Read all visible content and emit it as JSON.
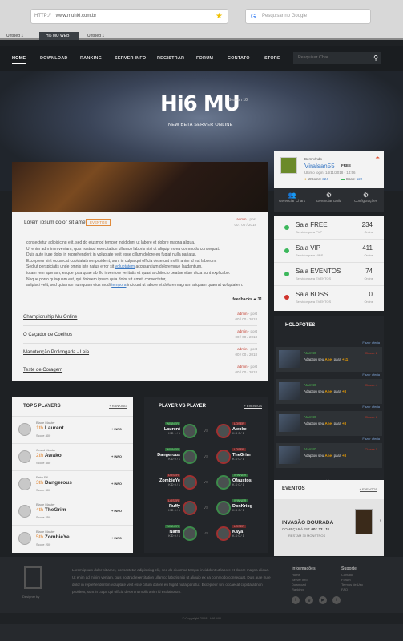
{
  "browser": {
    "protocol": "HTTP://",
    "url": "www.muhi6.com.br",
    "search_placeholder": "Pesquisar no Google",
    "tabs": [
      "Untitled 1",
      "Hi6 MU WEB",
      "Untitled 1"
    ]
  },
  "nav": {
    "items": [
      "HOME",
      "DOWNLOAD",
      "RANKING",
      "SERVER INFO",
      "REGISTRAR",
      "FORUM",
      "CONTATO",
      "STORE"
    ],
    "search_placeholder": "Pesquisar Char"
  },
  "hero": {
    "logo": "Hi6 MU",
    "season": "Season 10",
    "subtitle": "NEW BETA SERVER ONLINE"
  },
  "post": {
    "title": "Lorem ipsum dolor sit amet",
    "badge": "EVENTOS",
    "author": "admin",
    "meta_sep": " - ",
    "meta_type": "post",
    "date": "00 / 00 / 2018",
    "lines": [
      "consectetur adipisicing elit, sed do eiusmod tempor incididunt ut labore et dolore magna aliqua.",
      "Ut enim ad minim veniam, quis nostrud exercitation ullamco laboris nisi ut aliquip ex ea commodo consequat.",
      "Duis aute irure dolor in reprehenderit in voluptate velit esse cillum dolore eu fugiat nulla pariatur.",
      "Excepteur sint occaecat cupidatat non proident, sunt in culpa qui officia deserunt mollit anim id est laborum.",
      "Sed ut perspiciatis unde omnis iste natus error sit",
      "voluptatem",
      " accusantium doloremque laudantium,",
      "totam rem aperiam, eaque ipsa quae ab illo inventore veritatis et quasi architecto beatae vitae dicta sunt explicabo.",
      "Neque porro quisquam est, qui dolorem ipsum quia dolor sit amet, consectetur,",
      "adipisci velit, sed quia non numquam eius modi ",
      "tempora",
      " incidunt ut labore et dolore magnam aliquam quaerat voluptatem."
    ],
    "feedbacks_label": "feedbacks",
    "feedbacks_count": "31"
  },
  "posts": [
    {
      "title": "Championship Mu Online",
      "author": "admin",
      "meta_type": "post",
      "date": "00 / 00 / 2018"
    },
    {
      "title": "O Caçador de Coelhos",
      "author": "admin",
      "meta_type": "post",
      "date": "00 / 00 / 2018"
    },
    {
      "title": "Manutenção Prolongada - Leia",
      "author": "admin",
      "meta_type": "post",
      "date": "00 / 00 / 2018"
    },
    {
      "title": "Teste de Coragem",
      "author": "admin",
      "meta_type": "post",
      "date": "00 / 00 / 2018"
    }
  ],
  "user": {
    "welcome": "Bem Vindo",
    "name": "Viralsan55",
    "plan": "FREE",
    "last_login": "Último login: 14/11/2018 - 14:56",
    "wcoins_label": "WCoins:",
    "wcoins": "324",
    "cash_label": "Cash:",
    "cash": "122",
    "buttons": [
      "Gerenciar Chars",
      "Gerenciar Guild",
      "Configurações"
    ]
  },
  "servers": [
    {
      "name": "Sala FREE",
      "desc": "Servidor para PVP",
      "count": "234",
      "status": "Online",
      "color": "#3cb85c"
    },
    {
      "name": "Sala VIP",
      "desc": "Servidor para VIPS",
      "count": "411",
      "status": "Online",
      "color": "#3cb85c"
    },
    {
      "name": "Sala EVENTOS",
      "desc": "Servidor para EVENTOS",
      "count": "74",
      "status": "Online",
      "color": "#3cb85c"
    },
    {
      "name": "Sala BOSS",
      "desc": "Servidor para EVENTOS",
      "count": "0",
      "status": "Online",
      "color": "#d0342c"
    }
  ],
  "holofotes": {
    "title": "HOLOFOTES",
    "action_label": "Fazer oferta",
    "items": [
      {
        "who": "Atam40",
        "cls": "Classe 2",
        "pre": "Adaptou seu",
        "item": "Anel",
        "mid": "para",
        "lvl": "+11"
      },
      {
        "who": "Atam40",
        "cls": "Classe 4",
        "pre": "Adaptou seu",
        "item": "Anel",
        "mid": "para",
        "lvl": "+8"
      },
      {
        "who": "Atam40",
        "cls": "Classe 6",
        "pre": "Adaptou seu",
        "item": "Anel",
        "mid": "para",
        "lvl": "+8"
      },
      {
        "who": "Atam40",
        "cls": "Classe 1",
        "pre": "Adaptou seu",
        "item": "Anel",
        "mid": "para",
        "lvl": "+8"
      }
    ]
  },
  "top5": {
    "title": "TOP 5 PLAYERS",
    "link": "+ RANKING",
    "info_label": "+ INFO",
    "score_label": "Score",
    "players": [
      {
        "cls": "Blade Master",
        "rank": "1th",
        "name": "Laurent",
        "score": "400"
      },
      {
        "cls": "Grand Master",
        "rank": "2th",
        "name": "Awako",
        "score": "350"
      },
      {
        "cls": "Fairy Elf",
        "rank": "3th",
        "name": "Dangerous",
        "score": "300"
      },
      {
        "cls": "Blade Master",
        "rank": "4th",
        "name": "TheGrim",
        "score": "250"
      },
      {
        "cls": "Blade Master",
        "rank": "5th",
        "name": "ZombieYe",
        "score": "200"
      }
    ]
  },
  "pvp": {
    "title": "PLAYER VS PLAYER",
    "link": "+ EVENTOS",
    "vs": "VS",
    "duels": [
      {
        "l_tag": "WINNER",
        "l_name": "Laurent",
        "l_kd": "K.D 1 / 1",
        "r_tag": "LOSER",
        "r_name": "Awoke",
        "r_kd": "K.D 0 / 1"
      },
      {
        "l_tag": "WINNER",
        "l_name": "Dangerous",
        "l_kd": "K.D 0 / 1",
        "r_tag": "LOSER",
        "r_name": "TheGrim",
        "r_kd": "K.D 0 / 1"
      },
      {
        "l_tag": "LOSER",
        "l_name": "ZombieYe",
        "l_kd": "K.D 0 / 1",
        "r_tag": "WINNER",
        "r_name": "Ofaustos",
        "r_kd": "K.D 0 / 1"
      },
      {
        "l_tag": "LOSER",
        "l_name": "Ruffy",
        "l_kd": "K.D 0 / 1",
        "r_tag": "WINNER",
        "r_name": "DonKriog",
        "r_kd": "K.D 0 / 1"
      },
      {
        "l_tag": "WINNER",
        "l_name": "Nami",
        "l_kd": "K.D 0 / 1",
        "r_tag": "LOSER",
        "r_name": "Kaya",
        "r_kd": "K.D 0 / 1"
      }
    ]
  },
  "eventos": {
    "title": "EVENTOS",
    "link": "+ EVENTOS",
    "event": "INVASÃO DOURADA",
    "begins_label": "COMEÇARÁ EM:",
    "time": "00 : 32 : 11",
    "remaining": "RESTAM 30 MONSTROS"
  },
  "footer": {
    "designer": "Designer by",
    "text": "Lorem ipsum dolor sit amet, consectetur adipisicing elit, sed do eiusmod tempor incididunt ut labore et dolore magna aliqua. Ut enim ad minim veniam, quis nostrud exercitation ullamco laboris nisi ut aliquip ex ea commodo consequat. Duis aute irure dolor in reprehenderit in voluptate velit esse cillum dolore eu fugiat nulla pariatur. Excepteur sint occaecat cupidatat non proident, sunt in culpa qui officia deserunt mollit anim id est laborum.",
    "info_title": "Informações",
    "info_links": [
      "Home",
      "Server Info",
      "Download",
      "Ranking"
    ],
    "support_title": "Suporte",
    "support_links": [
      "Contato",
      "Fórum",
      "Termos de Uso",
      "FAQ"
    ],
    "copyright": "© Copyright 2018 - HI6 MU"
  }
}
